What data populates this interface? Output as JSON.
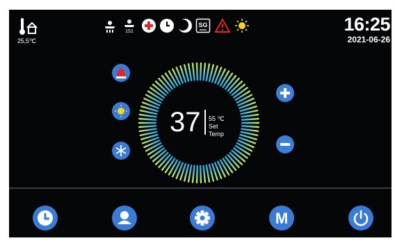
{
  "status": {
    "indoor_temp": "25,5℃",
    "time": "16:25",
    "date": "2021-06-26",
    "icons": [
      "fan-speed-icon",
      "fan-speed-level-icon",
      "heating-element-icon",
      "timer-icon",
      "night-mode-icon",
      "sg-ready-icon",
      "alarm-warning-icon",
      "sun-icon"
    ],
    "fan_level_text": "151",
    "sg_text": "SG"
  },
  "thermostat": {
    "current_temp": "37",
    "set_temp_value": "55 ℃",
    "set_temp_label": "Set Temp"
  },
  "modes": [
    "hot-water-mode-icon",
    "heating-mode-icon",
    "cooling-mode-icon"
  ],
  "nav": [
    "clock-icon",
    "user-icon",
    "settings-gear-icon",
    "mode-m-icon",
    "power-icon"
  ],
  "nav_m_label": "M",
  "colors": {
    "accent": "#3a7bd5",
    "background": "#050607",
    "dial_inner": "#2fa8d9",
    "dial_outer": "#c8e85a",
    "alarm": "#e0262b",
    "heat": "#e0262b"
  }
}
